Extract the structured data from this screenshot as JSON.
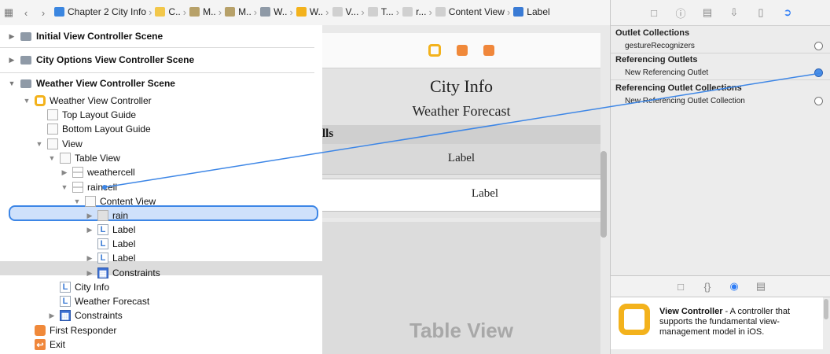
{
  "jumpbar": {
    "crumbs": [
      {
        "label": "Chapter 2 City Info",
        "color": "#3b86e0"
      },
      {
        "label": "C..",
        "color": "#f2c74a"
      },
      {
        "label": "M..",
        "color": "#b7a169"
      },
      {
        "label": "M..",
        "color": "#b7a169"
      },
      {
        "label": "W..",
        "color": "#8f9aa7"
      },
      {
        "label": "W..",
        "color": "#f3b21c"
      },
      {
        "label": "V...",
        "color": "#d0d0d0"
      },
      {
        "label": "T...",
        "color": "#d0d0d0"
      },
      {
        "label": "r...",
        "color": "#d0d0d0"
      },
      {
        "label": "Content View",
        "color": "#d0d0d0"
      },
      {
        "label": "Label",
        "color": "#3a7bd5"
      }
    ]
  },
  "outline": {
    "scenes": [
      "Initial View Controller Scene",
      "City Options View Controller Scene",
      "Weather View Controller Scene"
    ],
    "items": {
      "weather_vc": "Weather View Controller",
      "top_guide": "Top Layout Guide",
      "bottom_guide": "Bottom Layout Guide",
      "view": "View",
      "table_view": "Table View",
      "weathercell": "weathercell",
      "raincell": "raincell",
      "content_view": "Content View",
      "rain": "rain",
      "label1": "Label",
      "label2": "Label",
      "label3": "Label",
      "constraints_inner": "Constraints",
      "city_info": "City Info",
      "weather_forecast": "Weather Forecast",
      "constraints_outer": "Constraints",
      "first_responder": "First Responder",
      "exit": "Exit"
    }
  },
  "canvas": {
    "title": "City Info",
    "subtitle": "Weather Forecast",
    "section_header": "lls",
    "cell1_label": "Label",
    "cell2_label": "Label",
    "placeholder": "Table View"
  },
  "inspector": {
    "outlet_collections": "Outlet Collections",
    "gesture": "gestureRecognizers",
    "referencing_outlets": "Referencing Outlets",
    "new_ref_outlet": "New Referencing Outlet",
    "referencing_collections": "Referencing Outlet Collections",
    "new_ref_collection": "New Referencing Outlet Collection",
    "lib_title": "View Controller",
    "lib_desc": " - A controller that supports the fundamental view-management model in iOS."
  },
  "colors": {
    "accent": "#2d7cf6",
    "vc_yellow": "#f3b21c",
    "selection": "#3d86e6"
  }
}
